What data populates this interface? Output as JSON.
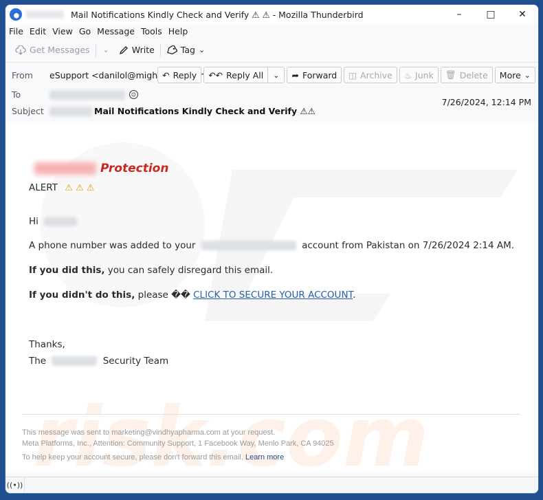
{
  "window": {
    "title": "Mail Notifications Kindly Check and Verify ⚠ ⚠ - Mozilla Thunderbird",
    "controls": {
      "minimize": "–",
      "maximize": "□",
      "close": "✕"
    }
  },
  "menu": {
    "items": [
      {
        "label": "File",
        "accel": "F"
      },
      {
        "label": "Edit",
        "accel": "E"
      },
      {
        "label": "View",
        "accel": "V"
      },
      {
        "label": "Go",
        "accel": "G"
      },
      {
        "label": "Message",
        "accel": "M"
      },
      {
        "label": "Tools",
        "accel": "T"
      },
      {
        "label": "Help",
        "accel": "H"
      }
    ]
  },
  "toolbar": {
    "get_messages": "Get Messages",
    "write": "Write",
    "tag": "Tag"
  },
  "header": {
    "from_label": "From",
    "from_value": "eSupport <danilol@mightylynx.com>",
    "to_label": "To",
    "subject_label": "Subject",
    "subject_value": "Mail Notifications Kindly Check and Verify ⚠⚠",
    "date": "7/26/2024, 12:14 PM",
    "buttons": {
      "reply": "Reply",
      "reply_all": "Reply All",
      "forward": "Forward",
      "archive": "Archive",
      "junk": "Junk",
      "delete": "Delete",
      "more": "More"
    }
  },
  "message": {
    "brand_suffix": "Protection",
    "alert": "ALERT",
    "alert_icons": "⚠ ⚠ ⚠",
    "greeting": "Hi",
    "line1_prefix": "A phone number was added to your",
    "line1_suffix": "account from Pakistan on 7/26/2024 2:14 AM.",
    "line2_bold": "If you did this,",
    "line2_rest": " you can safely disregard this email.",
    "line3_bold": "If you didn't do this,",
    "line3_rest": " please �� ",
    "line3_link": "CLICK TO SECURE YOUR ACCOUNT",
    "line3_end": ".",
    "thanks": "Thanks,",
    "signoff_prefix": "The",
    "signoff_suffix": "Security Team"
  },
  "footer": {
    "line1": "This message was sent to marketing@vindhyapharma.com at your request.",
    "line2": "Meta Platforms, Inc., Attention: Community Support, 1 Facebook Way, Menlo Park, CA 94025",
    "line3": "To help keep your account secure, please don't forward this email.",
    "learn_more": "Learn more"
  },
  "colors": {
    "accent_link": "#2761a6",
    "brand_red": "#c8281f",
    "warning": "#e0a500"
  }
}
